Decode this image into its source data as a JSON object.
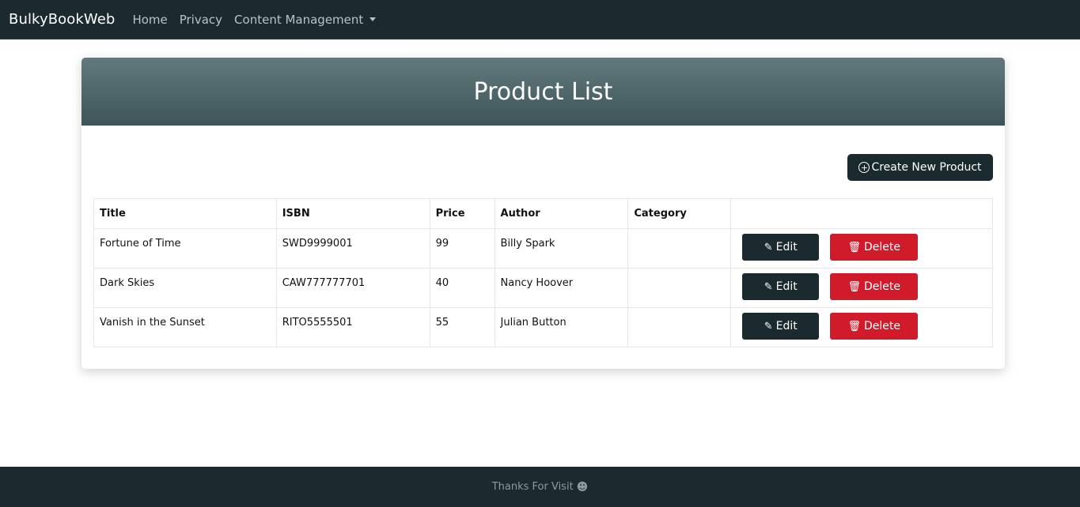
{
  "navbar": {
    "brand": "BulkyBookWeb",
    "links": [
      "Home",
      "Privacy",
      "Content Management"
    ]
  },
  "card": {
    "title": "Product List",
    "create_button": "Create New Product"
  },
  "table": {
    "headers": [
      "Title",
      "ISBN",
      "Price",
      "Author",
      "Category",
      ""
    ],
    "rows": [
      {
        "title": "Fortune of Time",
        "isbn": "SWD9999001",
        "price": "99",
        "author": "Billy Spark",
        "category": ""
      },
      {
        "title": "Dark Skies",
        "isbn": "CAW777777701",
        "price": "40",
        "author": "Nancy Hoover",
        "category": ""
      },
      {
        "title": "Vanish in the Sunset",
        "isbn": "RITO5555501",
        "price": "55",
        "author": "Julian Button",
        "category": ""
      }
    ],
    "edit_label": "Edit",
    "delete_label": "Delete"
  },
  "footer": {
    "text": "Thanks For Visit"
  },
  "colors": {
    "navbar": "#1b2a2f",
    "header_gradient_top": "#627a7d",
    "header_gradient_bottom": "#3d5458",
    "delete": "#d11a2a"
  }
}
